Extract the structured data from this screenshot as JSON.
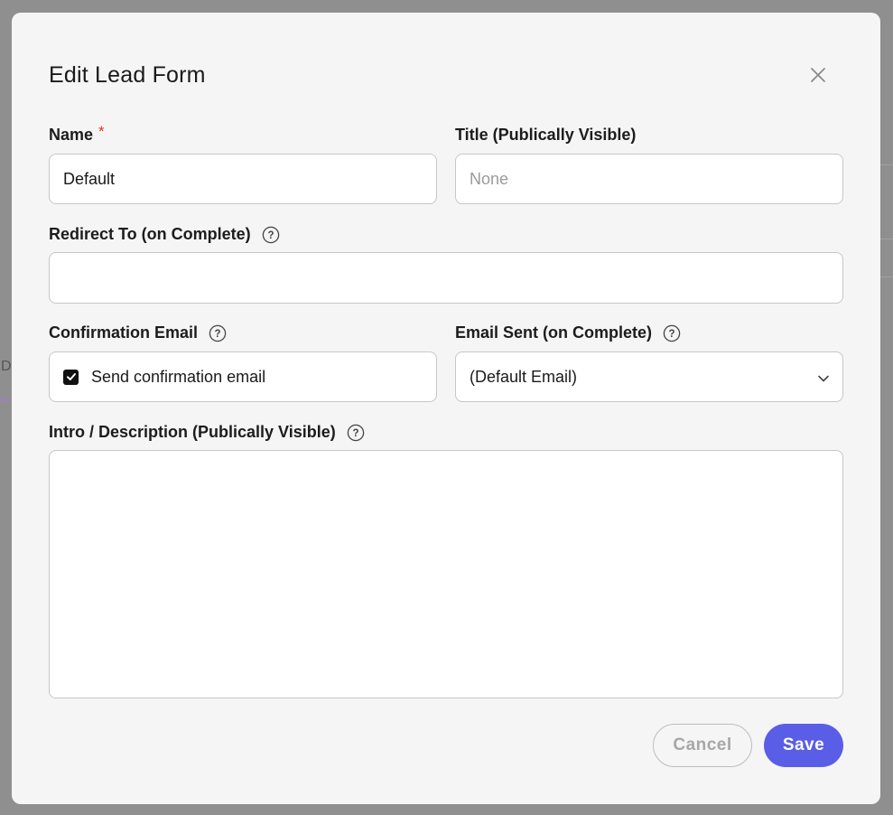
{
  "background": {
    "letter": "D"
  },
  "modal": {
    "title": "Edit Lead Form",
    "close_icon": "close-icon"
  },
  "fields": {
    "name": {
      "label": "Name",
      "required_mark": "*",
      "value": "Default"
    },
    "title": {
      "label": "Title (Publically Visible)",
      "placeholder": "None"
    },
    "redirect": {
      "label": "Redirect To (on Complete)",
      "value": ""
    },
    "confirmation": {
      "label": "Confirmation Email",
      "checkbox_label": "Send confirmation email",
      "checked": true
    },
    "email_sent": {
      "label": "Email Sent (on Complete)",
      "selected": "(Default Email)"
    },
    "intro": {
      "label": "Intro / Description (Publically Visible)",
      "value": ""
    }
  },
  "buttons": {
    "cancel": "Cancel",
    "save": "Save"
  },
  "colors": {
    "accent": "#5a5ee6",
    "required": "#e0382b"
  }
}
